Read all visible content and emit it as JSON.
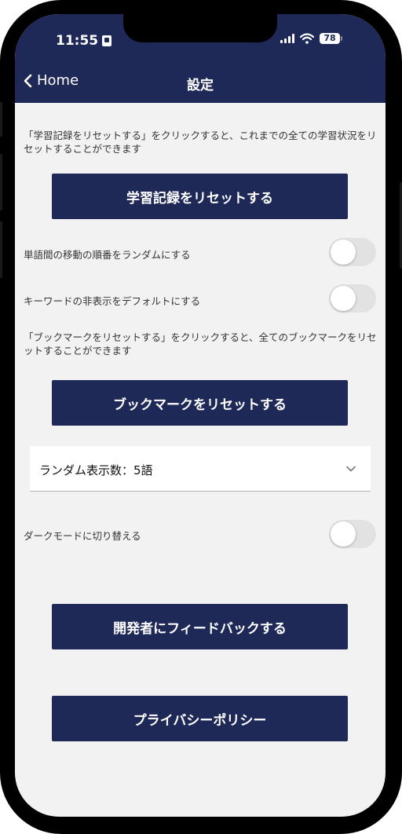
{
  "status_bar": {
    "time": "11:55",
    "battery": "78"
  },
  "nav": {
    "back_label": "Home",
    "title": "設定"
  },
  "settings": {
    "reset_progress_desc": "「学習記録をリセットする」をクリックすると、これまでの全ての学習状況をリセットすることができます",
    "reset_progress_button": "学習記録をリセットする",
    "random_order_label": "単語間の移動の順番をランダムにする",
    "hide_keywords_label": "キーワードの非表示をデフォルトにする",
    "reset_bookmarks_desc": "「ブックマークをリセットする」をクリックすると、全てのブックマークをリセットすることができます",
    "reset_bookmarks_button": "ブックマークをリセットする",
    "random_count_select": "ランダム表示数：5語",
    "dark_mode_label": "ダークモードに切り替える",
    "feedback_button": "開発者にフィードバックする",
    "privacy_button": "プライバシーポリシー"
  },
  "toggles": {
    "random_order": false,
    "hide_keywords": false,
    "dark_mode": false
  },
  "colors": {
    "header": "#1f2957",
    "button": "#1f2957",
    "background": "#f2f2f2"
  },
  "icons": [
    "lock-icon",
    "signal-icon",
    "wifi-icon",
    "battery-icon",
    "chevron-left-icon",
    "chevron-down-icon"
  ]
}
